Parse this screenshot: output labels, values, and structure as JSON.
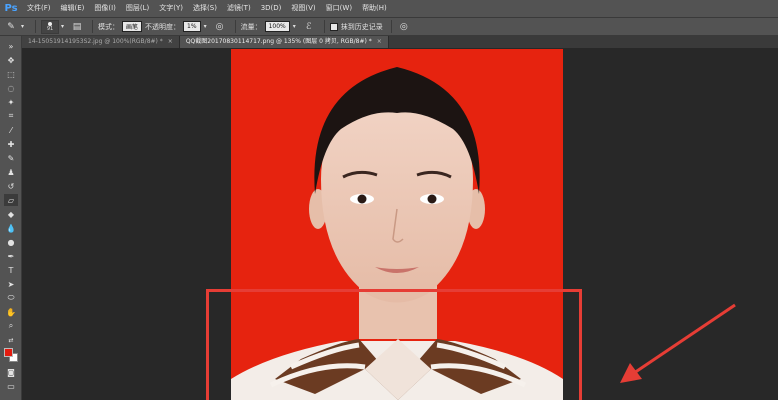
{
  "app": {
    "logo": "Ps"
  },
  "menu": [
    "文件(F)",
    "编辑(E)",
    "图像(I)",
    "图层(L)",
    "文字(Y)",
    "选择(S)",
    "滤镜(T)",
    "3D(D)",
    "视图(V)",
    "窗口(W)",
    "帮助(H)"
  ],
  "options": {
    "brush_size": "91",
    "mode_label": "模式：",
    "mode_value": "画笔",
    "opacity_label": "不透明度：",
    "opacity_value": "1%",
    "flow_label": "流量：",
    "flow_value": "100%",
    "history_label": "抹到历史记录"
  },
  "tabs": [
    {
      "label": "14-150519141953S2.jpg @ 100%(RGB/8#) *",
      "close": "×"
    },
    {
      "label": "QQ截图20170830114717.png @ 135% (图层 0 拷贝, RGB/8#) *",
      "close": "×"
    }
  ],
  "colors": {
    "foreground": "#e31b0f",
    "background": "#ffffff",
    "highlight": "#e63d35"
  }
}
